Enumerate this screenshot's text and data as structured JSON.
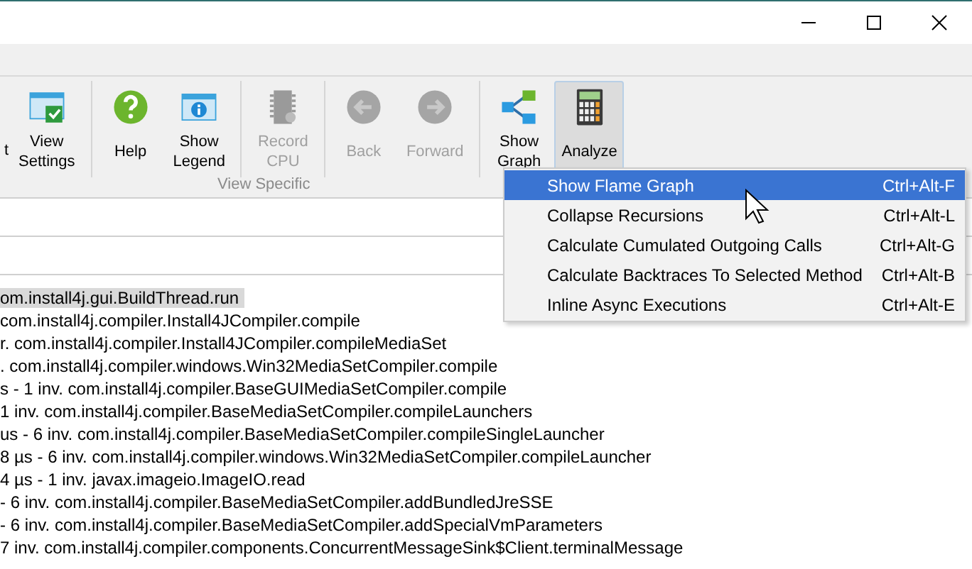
{
  "ribbon": {
    "cut_label": "t",
    "buttons": [
      {
        "kind": "view-settings",
        "label": "View Settings",
        "disabled": false,
        "pressed": false
      },
      {
        "kind": "sep"
      },
      {
        "kind": "help",
        "label": "Help",
        "disabled": false,
        "pressed": false
      },
      {
        "kind": "legend",
        "label": "Show Legend",
        "disabled": false,
        "pressed": false
      },
      {
        "kind": "sep"
      },
      {
        "kind": "cpu",
        "label": "Record CPU",
        "disabled": true,
        "pressed": false
      },
      {
        "kind": "sep"
      },
      {
        "kind": "back",
        "label": "Back",
        "disabled": true,
        "pressed": false
      },
      {
        "kind": "forward",
        "label": "Forward",
        "disabled": true,
        "pressed": false
      },
      {
        "kind": "sep"
      },
      {
        "kind": "graph",
        "label": "Show Graph",
        "disabled": false,
        "pressed": false
      },
      {
        "kind": "analyze",
        "label": "Analyze",
        "disabled": false,
        "pressed": true
      }
    ],
    "group_label": "View Specific"
  },
  "menu": {
    "items": [
      {
        "label": "Show Flame Graph",
        "shortcut": "Ctrl+Alt-F",
        "selected": true
      },
      {
        "label": "Collapse Recursions",
        "shortcut": "Ctrl+Alt-L",
        "selected": false
      },
      {
        "label": "Calculate Cumulated Outgoing Calls",
        "shortcut": "Ctrl+Alt-G",
        "selected": false
      },
      {
        "label": "Calculate Backtraces To Selected Method",
        "shortcut": "Ctrl+Alt-B",
        "selected": false
      },
      {
        "label": "Inline Async Executions",
        "shortcut": "Ctrl+Alt-E",
        "selected": false
      }
    ]
  },
  "tree": {
    "rows": [
      {
        "text": "om.install4j.gui.BuildThread.run",
        "selected": true
      },
      {
        "text": "com.install4j.compiler.Install4JCompiler.compile",
        "selected": false
      },
      {
        "text": "r. com.install4j.compiler.Install4JCompiler.compileMediaSet",
        "selected": false
      },
      {
        "text": ". com.install4j.compiler.windows.Win32MediaSetCompiler.compile",
        "selected": false
      },
      {
        "text": "s - 1 inv. com.install4j.compiler.BaseGUIMediaSetCompiler.compile",
        "selected": false
      },
      {
        "text": "1 inv. com.install4j.compiler.BaseMediaSetCompiler.compileLaunchers",
        "selected": false
      },
      {
        "text": "us - 6 inv. com.install4j.compiler.BaseMediaSetCompiler.compileSingleLauncher",
        "selected": false
      },
      {
        "text": "8 µs - 6 inv. com.install4j.compiler.windows.Win32MediaSetCompiler.compileLauncher",
        "selected": false
      },
      {
        "text": "4 µs - 1 inv. javax.imageio.ImageIO.read",
        "selected": false
      },
      {
        "text": "- 6 inv. com.install4j.compiler.BaseMediaSetCompiler.addBundledJreSSE",
        "selected": false
      },
      {
        "text": "- 6 inv. com.install4j.compiler.BaseMediaSetCompiler.addSpecialVmParameters",
        "selected": false
      },
      {
        "text": "7 inv. com.install4j.compiler.components.ConcurrentMessageSink$Client.terminalMessage",
        "selected": false
      }
    ]
  }
}
